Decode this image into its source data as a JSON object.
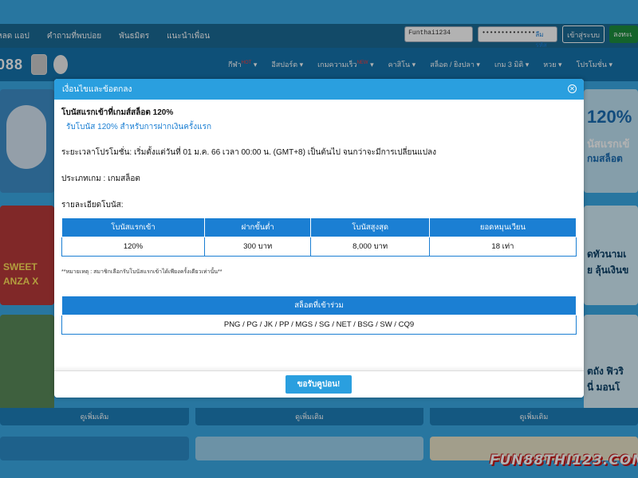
{
  "topbar": {
    "links": [
      "หลด แอป",
      "คำถามที่พบบ่อย",
      "พันธมิตร",
      "แนะนำเพื่อน"
    ],
    "username_value": "Funthai1234",
    "password_mask": "••••••••••••••",
    "forgot_label": "ลืมรหัสผ่าน ?",
    "login_label": "เข้าสู่ระบบ",
    "register_label": "ลงทะเ"
  },
  "navbar": {
    "logo_text": "088",
    "items": [
      {
        "label": "กีฬา",
        "hot": "HOT"
      },
      {
        "label": "อีสปอร์ต",
        "hot": ""
      },
      {
        "label": "เกมความเร็ว",
        "hot": "NEW"
      },
      {
        "label": "คาสิโน",
        "hot": ""
      },
      {
        "label": "สล็อต / ยิงปลา",
        "hot": ""
      },
      {
        "label": "เกม 3 มิติ",
        "hot": ""
      },
      {
        "label": "หวย",
        "hot": ""
      },
      {
        "label": "โปรโมชั่น",
        "hot": ""
      }
    ]
  },
  "background": {
    "card_footer": "ดูเพิ่มเติม",
    "promo_right_1": "120%",
    "promo_right_2": "นัสแรกเข้",
    "promo_right_3": "กมสล็อต",
    "promo_right_4": "ดทัวนามเ",
    "promo_right_5": "ย ลุ้นเงินข",
    "promo_right_6": "ตถัง ฟิวริ",
    "promo_right_7": "นี่ มอนโ",
    "promo_left_1": "SWEET",
    "promo_left_2": "ANZA X"
  },
  "watermark": "FUN88THI123.COM",
  "modal": {
    "title": "เงื่อนไขและข้อตกลง",
    "bonus_title": "โบนัสแรกเข้าที่เกมส์สล็อต 120%",
    "bonus_subtitle": "รับโบนัส 120% สำหรับการฝากเงินครั้งแรก",
    "period": "ระยะเวลาโปรโมชั่น: เริ่มตั้งแต่วันที่ 01 ม.ค. 66 เวลา 00:00 น. (GMT+8) เป็นต้นไป จนกว่าจะมีการเปลี่ยนแปลง",
    "game_type": "ประเภทเกม : เกมสล็อต",
    "details_label": "รายละเอียดโบนัส:",
    "table": {
      "headers": [
        "โบนัสแรกเข้า",
        "ฝากขั้นต่ำ",
        "โบนัสสูงสุด",
        "ยอดหมุนเวียน"
      ],
      "row": [
        "120%",
        "300 บาท",
        "8,000 บาท",
        "18 เท่า"
      ]
    },
    "note": "**หมายเหตุ : สมาชิกเลือกรับโบนัสแรกเข้าได้เพียงครั้งเดียวเท่านั้น**",
    "slots_table": {
      "header": "สล็อตที่เข้าร่วม",
      "value": "PNG / PG / JK / PP / MGS / SG / NET / BSG / SW / CQ9"
    },
    "accept_label": "ขอรับคูปอน!"
  },
  "colors": {
    "page_bg": "#3aa9e6",
    "modal_header": "#2a9fdf",
    "table_header": "#1b7fd3",
    "subtitle": "#1b7fd3"
  }
}
